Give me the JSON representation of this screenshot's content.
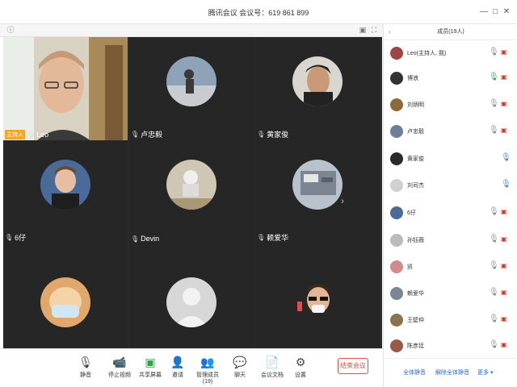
{
  "window": {
    "title": "腾讯会议 会议号：619 861 899"
  },
  "grid": {
    "tiles": [
      {
        "name": "Leo",
        "host_badge": "主持人",
        "type": "video"
      },
      {
        "name": "卢忠毅",
        "type": "avatar"
      },
      {
        "name": "黄家俊",
        "type": "avatar"
      },
      {
        "name": "6仔",
        "type": "avatar"
      },
      {
        "name": "Devin",
        "type": "avatar"
      },
      {
        "name": "赖爱华",
        "type": "avatar"
      },
      {
        "name": "",
        "type": "avatar"
      },
      {
        "name": "",
        "type": "avatar"
      },
      {
        "name": "",
        "type": "avatar"
      }
    ]
  },
  "toolbar": {
    "mute": "静音",
    "stop_video": "停止视频",
    "share_screen": "共享屏幕",
    "invite": "邀请",
    "manage_members": "管理成员(19)",
    "chat": "聊天",
    "docs": "会议文档",
    "settings": "设置",
    "end_meeting": "结束会议"
  },
  "panel": {
    "title": "成员(19人)",
    "members": [
      {
        "name": "Leo(主持人, 我)",
        "mic": "muted"
      },
      {
        "name": "博浪",
        "mic": "active"
      },
      {
        "name": "刘炳明",
        "mic": "muted"
      },
      {
        "name": "卢忠毅",
        "mic": "muted"
      },
      {
        "name": "黄家俊",
        "mic": "on"
      },
      {
        "name": "刘司杰",
        "mic": "on"
      },
      {
        "name": "6仔",
        "mic": "muted"
      },
      {
        "name": "孙钰薇",
        "mic": "muted"
      },
      {
        "name": "凯",
        "mic": "muted"
      },
      {
        "name": "赖爱华",
        "mic": "muted"
      },
      {
        "name": "王壁仲",
        "mic": "muted"
      },
      {
        "name": "陈彦廷",
        "mic": "muted"
      }
    ],
    "mute_all": "全体静音",
    "unmute_all": "解除全体静音",
    "more": "更多"
  }
}
